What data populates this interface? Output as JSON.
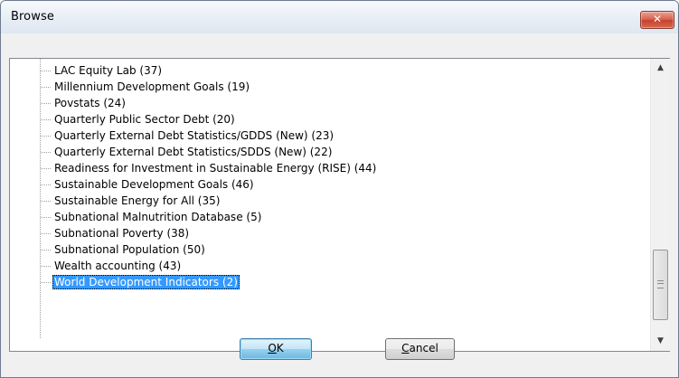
{
  "window": {
    "title": "Browse",
    "close_glyph": "✕"
  },
  "tree": {
    "items": [
      {
        "label": "LAC Equity Lab (37)",
        "selected": false
      },
      {
        "label": "Millennium Development Goals (19)",
        "selected": false
      },
      {
        "label": "Povstats (24)",
        "selected": false
      },
      {
        "label": "Quarterly Public Sector Debt (20)",
        "selected": false
      },
      {
        "label": "Quarterly External Debt Statistics/GDDS (New) (23)",
        "selected": false
      },
      {
        "label": "Quarterly External Debt Statistics/SDDS (New) (22)",
        "selected": false
      },
      {
        "label": "Readiness for Investment in Sustainable Energy (RISE) (44)",
        "selected": false
      },
      {
        "label": "Sustainable Development Goals  (46)",
        "selected": false
      },
      {
        "label": "Sustainable Energy for All (35)",
        "selected": false
      },
      {
        "label": "Subnational Malnutrition Database (5)",
        "selected": false
      },
      {
        "label": "Subnational Poverty (38)",
        "selected": false
      },
      {
        "label": "Subnational Population (50)",
        "selected": false
      },
      {
        "label": "Wealth accounting (43)",
        "selected": false
      },
      {
        "label": "World Development Indicators (2)",
        "selected": true
      }
    ]
  },
  "scrollbar": {
    "up_glyph": "▲",
    "down_glyph": "▼"
  },
  "buttons": {
    "ok": {
      "mnemonic": "O",
      "rest": "K"
    },
    "cancel": {
      "mnemonic": "C",
      "rest": "ancel"
    }
  },
  "colors": {
    "selection": "#3399ff",
    "close_button": "#c7412c",
    "default_button_border": "#3c7fb1"
  },
  "icons": {
    "close": "close-icon",
    "scroll_up": "scroll-up-arrow-icon",
    "scroll_down": "scroll-down-arrow-icon",
    "thumb_grip": "grip-icon"
  }
}
